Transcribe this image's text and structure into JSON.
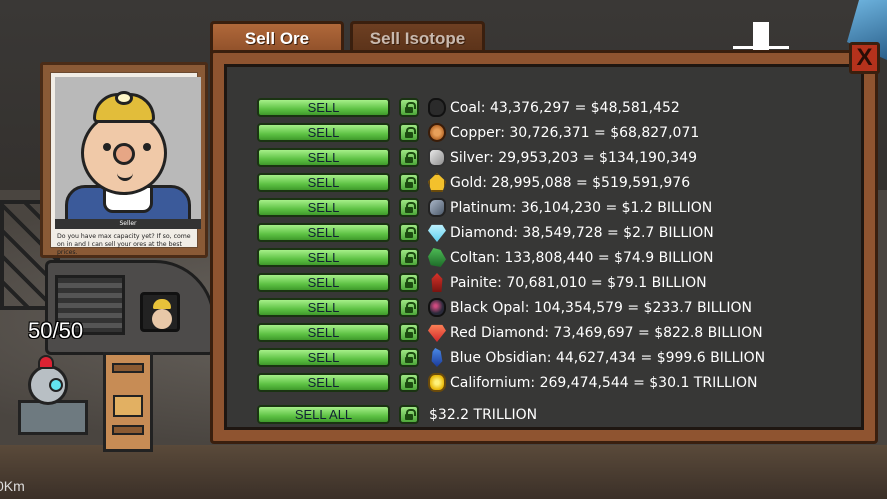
{
  "tabs": [
    {
      "label": "Sell Ore"
    },
    {
      "label": "Sell Isotope"
    }
  ],
  "close_label": "X",
  "seller": {
    "name": "Seller",
    "message": "Do you have max capacity yet? If so, come on in and I can sell your ores at the best prices."
  },
  "hud": {
    "cargo": "50/50",
    "depth": "0Km"
  },
  "ores": [
    {
      "button": "SELL",
      "icon": "coal-icon",
      "text": "Coal: 43,376,297 = $48,581,452"
    },
    {
      "button": "SELL",
      "icon": "copper-icon",
      "text": "Copper: 30,726,371 = $68,827,071"
    },
    {
      "button": "SELL",
      "icon": "silver-icon",
      "text": "Silver: 29,953,203 = $134,190,349"
    },
    {
      "button": "SELL",
      "icon": "gold-icon",
      "text": "Gold: 28,995,088 = $519,591,976"
    },
    {
      "button": "SELL",
      "icon": "platinum-icon",
      "text": "Platinum: 36,104,230 = $1.2 BILLION"
    },
    {
      "button": "SELL",
      "icon": "diamond-icon",
      "text": "Diamond: 38,549,728 = $2.7 BILLION"
    },
    {
      "button": "SELL",
      "icon": "coltan-icon",
      "text": "Coltan: 133,808,440 = $74.9 BILLION"
    },
    {
      "button": "SELL",
      "icon": "painite-icon",
      "text": "Painite: 70,681,010 = $79.1 BILLION"
    },
    {
      "button": "SELL",
      "icon": "black-opal-icon",
      "text": "Black Opal: 104,354,579 = $233.7 BILLION"
    },
    {
      "button": "SELL",
      "icon": "red-diamond-icon",
      "text": "Red Diamond: 73,469,697 = $822.8 BILLION"
    },
    {
      "button": "SELL",
      "icon": "blue-obsidian-icon",
      "text": "Blue Obsidian: 44,627,434 = $999.6 BILLION"
    },
    {
      "button": "SELL",
      "icon": "californium-icon",
      "text": "Californium: 269,474,544 = $30.1 TRILLION"
    }
  ],
  "sell_all": {
    "button": "SELL ALL",
    "total": "$32.2 TRILLION"
  },
  "colors": {
    "panel_wood": "#8f5430",
    "panel_inner": "#373736",
    "sell_button": "#5ec244",
    "close_button": "#b5321c"
  }
}
